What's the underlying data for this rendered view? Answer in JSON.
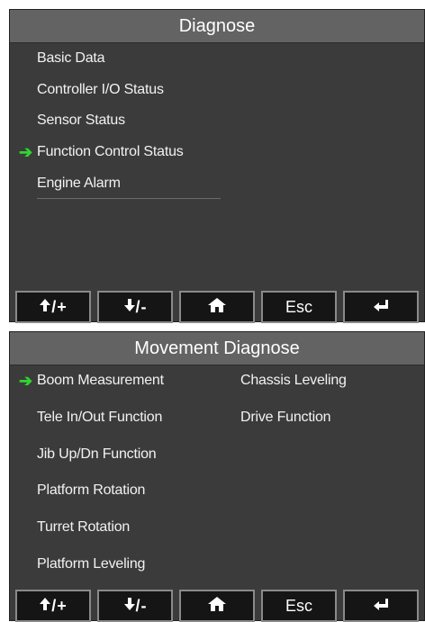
{
  "top_panel": {
    "title": "Diagnose",
    "items": [
      {
        "label": "Basic Data"
      },
      {
        "label": "Controller I/O Status"
      },
      {
        "label": "Sensor Status"
      },
      {
        "label": "Function Control Status",
        "selected": true
      },
      {
        "label": "Engine Alarm"
      }
    ]
  },
  "bottom_panel": {
    "title": "Movement Diagnose",
    "left_items": [
      {
        "label": "Boom Measurement",
        "selected": true
      },
      {
        "label": "Tele In/Out Function"
      },
      {
        "label": "Jib Up/Dn Function"
      },
      {
        "label": "Platform Rotation"
      },
      {
        "label": "Turret Rotation"
      },
      {
        "label": "Platform Leveling"
      }
    ],
    "right_items": [
      {
        "label": "Chassis Leveling"
      },
      {
        "label": "Drive Function"
      }
    ]
  },
  "buttons": {
    "up_plus": "/+",
    "down_minus": "/-",
    "esc": "Esc"
  },
  "icons": {
    "selection_marker": "right-arrow-icon",
    "up": "up-arrow-icon",
    "down": "down-arrow-icon",
    "home": "home-icon",
    "enter": "enter-icon"
  },
  "colors": {
    "panel_bg": "#3b3b3b",
    "title_bg": "#636363",
    "button_bg": "#151515",
    "button_border": "#8a8a8a",
    "selection_arrow": "#2fd52f",
    "text": "#f2f2f2"
  }
}
